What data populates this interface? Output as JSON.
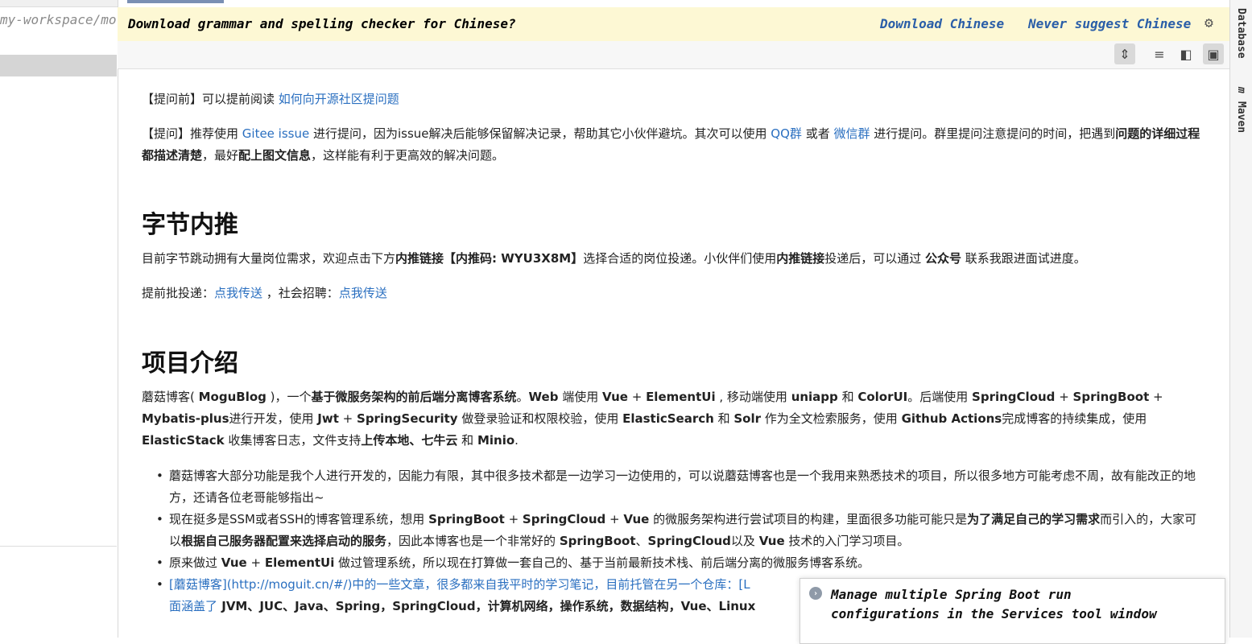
{
  "left_panel": {
    "path_text": "my-workspace/mo"
  },
  "right_strip": {
    "database_label": "Database",
    "maven_label": "Maven",
    "maven_icon": "m"
  },
  "banner": {
    "message": "Download grammar and spelling checker for Chinese?",
    "download_link": "Download Chinese",
    "never_link": "Never suggest Chinese",
    "gear_icon": "⚙"
  },
  "toolbar": {
    "btn1": "⇕",
    "btn2": "≡",
    "btn3": "◧",
    "btn4": "▣"
  },
  "content": {
    "p_before_prefix": "【提问前】可以提前阅读 ",
    "p_before_link": "如何向开源社区提问题",
    "p_ask_1": "【提问】推荐使用 ",
    "p_ask_link1": "Gitee issue",
    "p_ask_2": " 进行提问，因为issue解决后能够保留解决记录，帮助其它小伙伴避坑。其次可以使用 ",
    "p_ask_link2": "QQ群",
    "p_ask_3": " 或者 ",
    "p_ask_link3": "微信群",
    "p_ask_4": " 进行提问。群里提问注意提问的时间，把遇到",
    "p_ask_b1": "问题的详细过程都描述清楚",
    "p_ask_5": "，最好",
    "p_ask_b2": "配上图文信息",
    "p_ask_6": "，这样能有利于更高效的解决问题。",
    "h_bytedance": "字节内推",
    "p_bd_1": "目前字节跳动拥有大量岗位需求，欢迎点击下方",
    "p_bd_b1": "内推链接【内推码: WYU3X8M】",
    "p_bd_2": "选择合适的岗位投递。小伙伴们使用",
    "p_bd_b2": "内推链接",
    "p_bd_3": "投递后，可以通过 ",
    "p_bd_b3": "公众号",
    "p_bd_4": " 联系我跟进面试进度。",
    "p_early_1": "提前批投递：",
    "p_early_link1": "点我传送",
    "p_early_2": " ，社会招聘：",
    "p_early_link2": "点我传送",
    "h_intro": "项目介绍",
    "p_intro_1": "蘑菇博客( ",
    "p_intro_b1": "MoguBlog",
    "p_intro_2": " )，一个",
    "p_intro_b2": "基于微服务架构的前后端分离博客系统",
    "p_intro_3": "。",
    "p_intro_b3": "Web",
    "p_intro_4": " 端使用 ",
    "p_intro_b4": "Vue",
    "p_intro_5": " + ",
    "p_intro_b5": "ElementUi",
    "p_intro_6": " , 移动端使用 ",
    "p_intro_b6": "uniapp",
    "p_intro_7": " 和 ",
    "p_intro_b7": "ColorUI",
    "p_intro_8": "。后端使用 ",
    "p_intro_b8": "SpringCloud",
    "p_intro_9": " + ",
    "p_intro_b9": "SpringBoot",
    "p_intro_10": " + ",
    "p_intro_b10": "Mybatis-plus",
    "p_intro_11": "进行开发，使用 ",
    "p_intro_b11": "Jwt",
    "p_intro_12": " + ",
    "p_intro_b12": "SpringSecurity",
    "p_intro_13": " 做登录验证和权限校验，使用 ",
    "p_intro_b13": "ElasticSearch",
    "p_intro_14": " 和 ",
    "p_intro_b14": "Solr",
    "p_intro_15": " 作为全文检索服务，使用 ",
    "p_intro_b15": "Github Actions",
    "p_intro_16": "完成博客的持续集成，使用 ",
    "p_intro_b16": "ElasticStack",
    "p_intro_17": " 收集博客日志，文件支持",
    "p_intro_b17": "上传本地、七牛云",
    "p_intro_18": " 和 ",
    "p_intro_b18": "Minio",
    "p_intro_19": ".",
    "li1": "蘑菇博客大部分功能是我个人进行开发的，因能力有限，其中很多技术都是一边学习一边使用的，可以说蘑菇博客也是一个我用来熟悉技术的项目，所以很多地方可能考虑不周，故有能改正的地方，还请各位老哥能够指出~",
    "li2_1": "现在挺多是SSM或者SSH的博客管理系统，想用 ",
    "li2_b1": "SpringBoot",
    "li2_2": " + ",
    "li2_b2": "SpringCloud",
    "li2_3": " + ",
    "li2_b3": "Vue",
    "li2_4": " 的微服务架构进行尝试项目的构建，里面很多功能可能只是",
    "li2_b4": "为了满足自己的学习需求",
    "li2_5": "而引入的，大家可以",
    "li2_b5": "根据自己服务器配置来选择启动的服务",
    "li2_6": "，因此本博客也是一个非常好的 ",
    "li2_b6": "SpringBoot",
    "li2_7": "、",
    "li2_b7": "SpringCloud",
    "li2_8": "以及 ",
    "li2_b8": "Vue",
    "li2_9": " 技术的入门学习项目。",
    "li3_1": "原来做过 ",
    "li3_b1": "Vue",
    "li3_2": " + ",
    "li3_b2": "ElementUi",
    "li3_3": " 做过管理系统，所以现在打算做一套自己的、基于当前最新技术栈、前后端分离的微服务博客系统。",
    "li4_link1": "[蘑菇博客](http://moguit.cn/#/)中的一些文章，很多都来自我平时的学习笔记，目前托管在另一个仓库：[L",
    "li4_link2": "面涵盖了",
    "li4_rest": " JVM、JUC、Java、Spring，SpringCloud，计算机网络，操作系统，数据结构，Vue、Linux"
  },
  "popup": {
    "icon": "›",
    "line1": "Manage multiple Spring Boot run",
    "line2": "configurations in the Services tool window"
  }
}
